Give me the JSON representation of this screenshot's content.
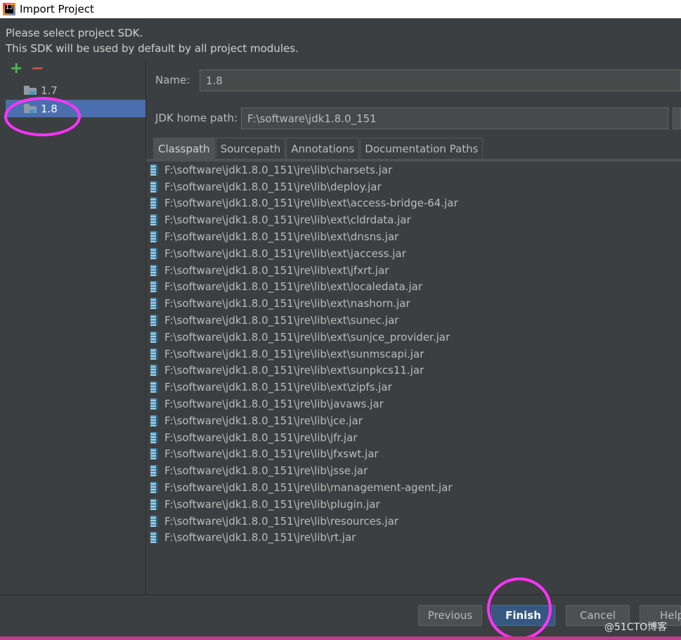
{
  "window": {
    "title": "Import Project"
  },
  "description": {
    "line1": "Please select project SDK.",
    "line2": "This SDK will be used by default by all project modules."
  },
  "toolbar": {
    "add": "+",
    "remove": "−"
  },
  "sdk_list": [
    {
      "label": "1.7",
      "selected": false
    },
    {
      "label": "1.8",
      "selected": true
    }
  ],
  "form": {
    "name_label": "Name:",
    "name_value": "1.8",
    "home_label": "JDK home path:",
    "home_value": "F:\\software\\jdk1.8.0_151"
  },
  "tabs": [
    {
      "label": "Classpath",
      "active": true
    },
    {
      "label": "Sourcepath",
      "active": false
    },
    {
      "label": "Annotations",
      "active": false
    },
    {
      "label": "Documentation Paths",
      "active": false
    }
  ],
  "classpath": [
    "F:\\software\\jdk1.8.0_151\\jre\\lib\\charsets.jar",
    "F:\\software\\jdk1.8.0_151\\jre\\lib\\deploy.jar",
    "F:\\software\\jdk1.8.0_151\\jre\\lib\\ext\\access-bridge-64.jar",
    "F:\\software\\jdk1.8.0_151\\jre\\lib\\ext\\cldrdata.jar",
    "F:\\software\\jdk1.8.0_151\\jre\\lib\\ext\\dnsns.jar",
    "F:\\software\\jdk1.8.0_151\\jre\\lib\\ext\\jaccess.jar",
    "F:\\software\\jdk1.8.0_151\\jre\\lib\\ext\\jfxrt.jar",
    "F:\\software\\jdk1.8.0_151\\jre\\lib\\ext\\localedata.jar",
    "F:\\software\\jdk1.8.0_151\\jre\\lib\\ext\\nashorn.jar",
    "F:\\software\\jdk1.8.0_151\\jre\\lib\\ext\\sunec.jar",
    "F:\\software\\jdk1.8.0_151\\jre\\lib\\ext\\sunjce_provider.jar",
    "F:\\software\\jdk1.8.0_151\\jre\\lib\\ext\\sunmscapi.jar",
    "F:\\software\\jdk1.8.0_151\\jre\\lib\\ext\\sunpkcs11.jar",
    "F:\\software\\jdk1.8.0_151\\jre\\lib\\ext\\zipfs.jar",
    "F:\\software\\jdk1.8.0_151\\jre\\lib\\javaws.jar",
    "F:\\software\\jdk1.8.0_151\\jre\\lib\\jce.jar",
    "F:\\software\\jdk1.8.0_151\\jre\\lib\\jfr.jar",
    "F:\\software\\jdk1.8.0_151\\jre\\lib\\jfxswt.jar",
    "F:\\software\\jdk1.8.0_151\\jre\\lib\\jsse.jar",
    "F:\\software\\jdk1.8.0_151\\jre\\lib\\management-agent.jar",
    "F:\\software\\jdk1.8.0_151\\jre\\lib\\plugin.jar",
    "F:\\software\\jdk1.8.0_151\\jre\\lib\\resources.jar",
    "F:\\software\\jdk1.8.0_151\\jre\\lib\\rt.jar"
  ],
  "buttons": {
    "previous": "Previous",
    "finish": "Finish",
    "cancel": "Cancel",
    "help": "Help"
  },
  "watermark": "@51CTO博客",
  "colors": {
    "accent": "#4b6eaf",
    "annotation": "#ff33ff",
    "primary_button": "#365880"
  }
}
